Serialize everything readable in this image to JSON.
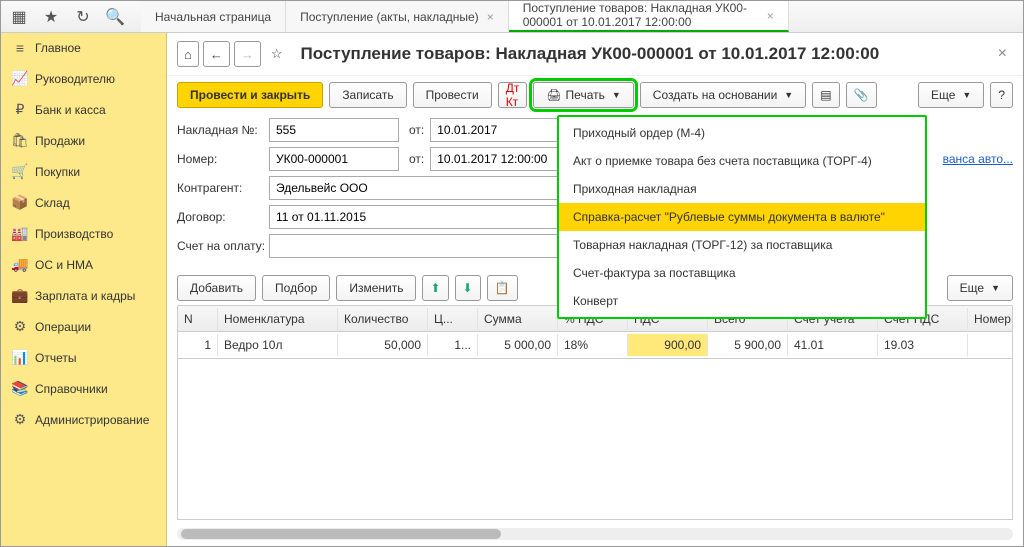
{
  "tabs": {
    "home": "Начальная страница",
    "receipts": "Поступление (акты, накладные)",
    "current": "Поступление товаров: Накладная УК00-000001 от 10.01.2017 12:00:00"
  },
  "sidebar": {
    "items": [
      "Главное",
      "Руководителю",
      "Банк и касса",
      "Продажи",
      "Покупки",
      "Склад",
      "Производство",
      "ОС и НМА",
      "Зарплата и кадры",
      "Операции",
      "Отчеты",
      "Справочники",
      "Администрирование"
    ]
  },
  "page": {
    "title": "Поступление товаров: Накладная УК00-000001 от 10.01.2017 12:00:00",
    "toolbar": {
      "post_close": "Провести и закрыть",
      "write": "Записать",
      "post": "Провести",
      "print": "Печать",
      "create_based": "Создать на основании",
      "more": "Еще",
      "help": "?"
    },
    "form": {
      "invoice_no_label": "Накладная №:",
      "invoice_no": "555",
      "from_short": "от:",
      "invoice_date": "10.01.2017",
      "number_label": "Номер:",
      "number": "УК00-000001",
      "number_date": "10.01.2017 12:00:00",
      "counterparty_label": "Контрагент:",
      "counterparty": "Эдельвейс ООО",
      "contract_label": "Договор:",
      "contract": "11 от 01.11.2015",
      "account_label": "Счет на оплату:",
      "account": "",
      "link_fragment": "ванса авто..."
    },
    "items_toolbar": {
      "add": "Добавить",
      "pick": "Подбор",
      "change": "Изменить",
      "more": "Еще"
    },
    "columns": [
      "N",
      "Номенклатура",
      "Количество",
      "Ц...",
      "Сумма",
      "% НДС",
      "НДС",
      "Всего",
      "Счет учета",
      "Счет НДС",
      "Номер ГТ"
    ],
    "rows": [
      {
        "n": "1",
        "name": "Ведро 10л",
        "qty": "50,000",
        "price": "1...",
        "sum": "5 000,00",
        "vat_pct": "18%",
        "vat": "900,00",
        "total": "5 900,00",
        "acc": "41.01",
        "vat_acc": "19.03",
        "gtd": ""
      }
    ]
  },
  "dropdown": {
    "items": [
      "Приходный ордер (М-4)",
      "Акт о приемке товара без счета поставщика (ТОРГ-4)",
      "Приходная накладная",
      "Справка-расчет \"Рублевые суммы документа в валюте\"",
      "Товарная накладная (ТОРГ-12) за поставщика",
      "Счет-фактура за поставщика",
      "Конверт"
    ],
    "highlight_index": 3
  }
}
